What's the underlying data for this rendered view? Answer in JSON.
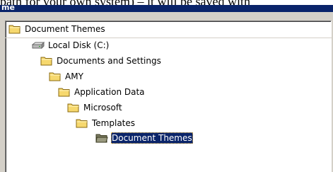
{
  "background_text": "path for your own system) – it will be saved with",
  "window": {
    "title_fragment": "me"
  },
  "combo": {
    "selected": "Document Themes"
  },
  "tree": [
    {
      "label": "Local Disk (C:)",
      "icon": "drive-icon",
      "selected": false
    },
    {
      "label": "Documents and Settings",
      "icon": "folder-icon",
      "selected": false
    },
    {
      "label": "AMY",
      "icon": "folder-icon",
      "selected": false
    },
    {
      "label": "Application Data",
      "icon": "folder-icon",
      "selected": false
    },
    {
      "label": "Microsoft",
      "icon": "folder-icon",
      "selected": false
    },
    {
      "label": "Templates",
      "icon": "folder-icon",
      "selected": false
    },
    {
      "label": "Document Themes",
      "icon": "folder-open-icon",
      "selected": true
    }
  ],
  "colors": {
    "titlebar": "#0a246a",
    "selection": "#0a246a",
    "folder_fill": "#f6d86e",
    "folder_edge": "#8a6a10",
    "dialog_face": "#d4d0c8"
  }
}
